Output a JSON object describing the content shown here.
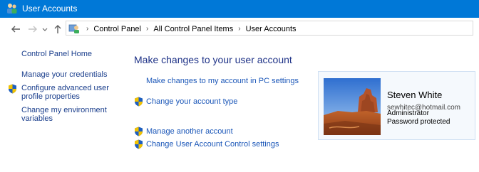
{
  "window": {
    "title": "User Accounts"
  },
  "breadcrumb": {
    "items": [
      "Control Panel",
      "All Control Panel Items",
      "User Accounts"
    ]
  },
  "sidebar": {
    "home": "Control Panel Home",
    "credentials": "Manage your credentials",
    "advanced_line1": "Configure advanced user",
    "advanced_line2": "profile properties",
    "environment_line1": "Change my environment",
    "environment_line2": "variables"
  },
  "main": {
    "heading": "Make changes to your user account",
    "links": {
      "pc_settings": "Make changes to my account in PC settings",
      "account_type": "Change your account type",
      "manage_another": "Manage another account",
      "uac_settings": "Change User Account Control settings"
    }
  },
  "user_card": {
    "name": "Steven White",
    "email": "sewhitec@hotmail.com",
    "role": "Administrator",
    "password_status": "Password protected"
  },
  "colors": {
    "titlebar": "#0078d7",
    "link": "#1a56b8",
    "heading": "#1e3287",
    "card_border": "#cfe0f3"
  },
  "icons": [
    "users-icon",
    "back-arrow-icon",
    "forward-arrow-icon",
    "dropdown-icon",
    "up-arrow-icon",
    "control-panel-icon",
    "shield-icon"
  ]
}
